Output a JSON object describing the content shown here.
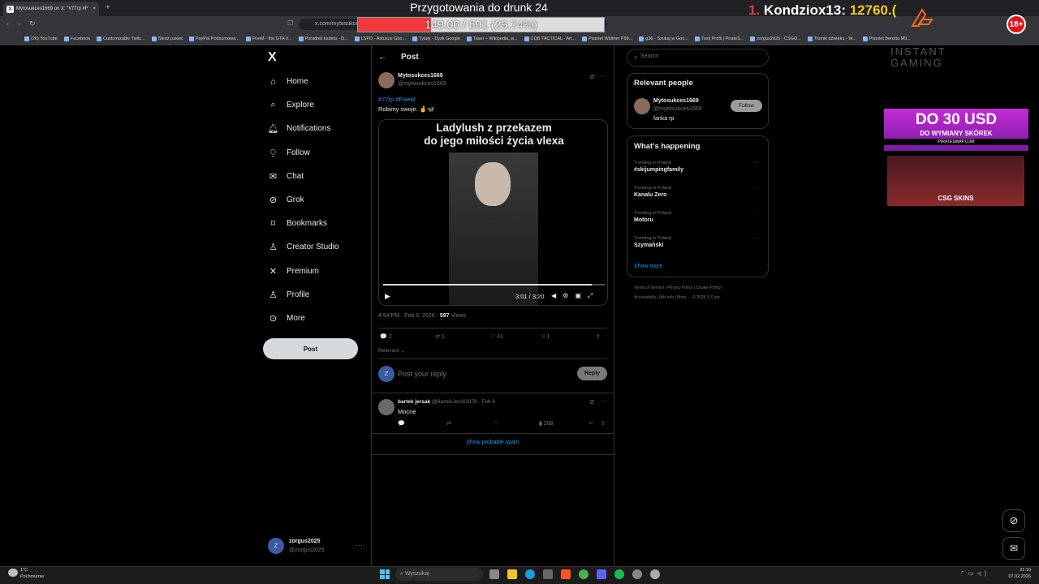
{
  "browser": {
    "tab_title": "Mytosukces1669 on X: \"#77rp #F",
    "tab_favicon": "X",
    "new_tab": "+",
    "url": "x.com/mytosukces",
    "bookmarks": [
      "(26) YouTube",
      "Facebook",
      "Customizable Twitc...",
      "Śledź pakiet",
      "PayPal Podsumowa...",
      "FiveM - the GTA V...",
      "Poradnik kadeta - D...",
      "LSPD - Arkusze Goo...",
      "Tytuły - Dysk Google",
      "Taser – Wikipedia, w...",
      "CQB TACTICAL - Art...",
      "Pistolet Walther P99...",
      "g36 - Szukaj w Goo...",
      "Twój Profil | PirateS...",
      "zorgus2025 - CSGO...",
      "Tłumik dźwięku - W...",
      "Pistolet Beretta M9..."
    ]
  },
  "overlay": {
    "title": "Przygotowania do drunk 24",
    "progress_text": "149.00 / 501 (29.74%)",
    "progress": 0.2974,
    "top_rank": "1.",
    "top_name": "Kondziox13:",
    "top_score": "12760.(",
    "age_badge": "18+",
    "brand_text": "INSTANT GAMING"
  },
  "sidebar": {
    "logo": "X",
    "items": [
      {
        "label": "Home",
        "icon": "home-icon"
      },
      {
        "label": "Explore",
        "icon": "search-icon"
      },
      {
        "label": "Notifications",
        "icon": "bell-icon"
      },
      {
        "label": "Follow",
        "icon": "follow-icon"
      },
      {
        "label": "Chat",
        "icon": "mail-icon"
      },
      {
        "label": "Grok",
        "icon": "grok-icon"
      },
      {
        "label": "Bookmarks",
        "icon": "bookmark-icon"
      },
      {
        "label": "Creator Studio",
        "icon": "creator-icon"
      },
      {
        "label": "Premium",
        "icon": "x-icon"
      },
      {
        "label": "Profile",
        "icon": "person-icon"
      },
      {
        "label": "More",
        "icon": "more-icon"
      }
    ],
    "post_button": "Post",
    "account_name": "zorgus2025",
    "account_handle": "@zorgus2025",
    "account_initial": "Z"
  },
  "post": {
    "header": "Post",
    "author_name": "Mytosukces1669",
    "author_handle": "@mytosukces1669",
    "hashtags": "#77rp #FiveM",
    "text": "Robimy swoje. 🤞🦋",
    "video_caption_1": "Ladylush z przekazem",
    "video_caption_2": "do jego miłości życia vlexa",
    "video_time": "3:01 / 3:20",
    "video_progress": 0.94,
    "timestamp": "4:54 PM · Feb 6, 2026 · ",
    "views_count": "597",
    "views_label": "Views",
    "replies": "2",
    "reposts": "1",
    "likes": "41",
    "bookmarks": "1",
    "sort_label": "Relevant ⌄",
    "reply_placeholder": "Post your reply",
    "reply_button": "Reply",
    "reply_initial": "Z"
  },
  "comment": {
    "author_name": "bartek jersak",
    "author_handle": "@BartekJers63978",
    "date": "· Feb 6",
    "text": "Mocne",
    "views": "268",
    "spam_link": "Show probable spam"
  },
  "right": {
    "search_placeholder": "Search",
    "relevant_title": "Relevant people",
    "person_name": "Mytosukces1669",
    "person_handle": "@mytosukces1669",
    "person_bio": "fanka rp",
    "follow_button": "Follow",
    "happening_title": "What's happening",
    "trends": [
      {
        "context": "Trending in Poland",
        "name": "#skijumpingfamily"
      },
      {
        "context": "Trending in Poland",
        "name": "Kanalu Zero"
      },
      {
        "context": "Trending in Poland",
        "name": "Motoru"
      },
      {
        "context": "Trending in Poland",
        "name": "Szymański"
      }
    ],
    "show_more": "Show more",
    "footer_1": "Terms of Service  |  Privacy Policy  |  Cookie Policy  |",
    "footer_2": "Accessibility  |  Ads info  |  More ···  © 2026 X Corp."
  },
  "ads": {
    "ad1_line1": "DO 30 USD",
    "ad1_line2": "DO WYMIANY SKÓREK",
    "ad1_line3": "PIRATESWAP.COM",
    "ad2_title": "CSG SKINS"
  },
  "taskbar": {
    "weather_temp": "1°C",
    "weather_desc": "Pochmurnie",
    "search_placeholder": "Wyszukaj",
    "time": "21:10",
    "date": "07.02.2026"
  },
  "colors": {
    "accent": "#1d9bf0",
    "overlay_red": "#f03a3f",
    "background": "#000000"
  }
}
